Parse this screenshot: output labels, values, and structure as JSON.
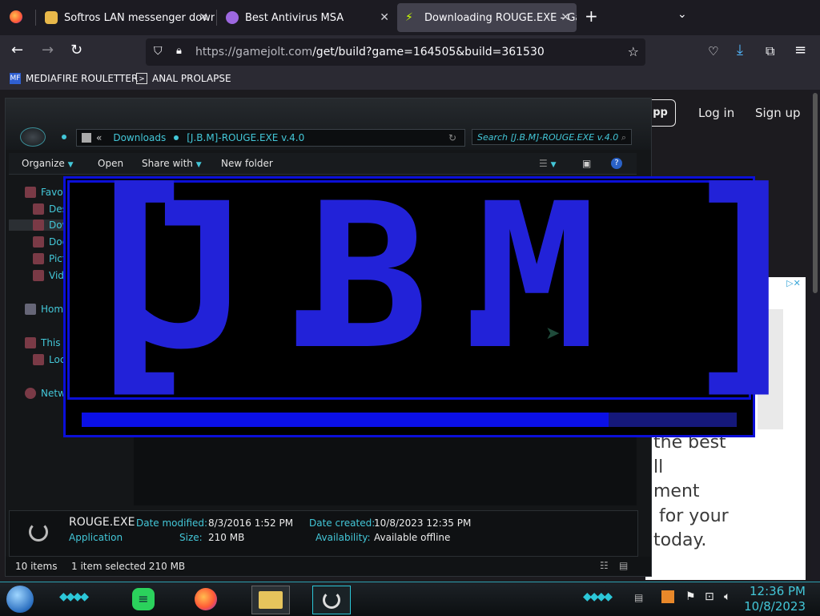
{
  "browser": {
    "tabs": [
      {
        "title": "Softros LAN messenger downlo",
        "active": false
      },
      {
        "title": "Best Antivirus MSA",
        "active": false
      },
      {
        "title": "Downloading ROUGE.EXE - Gan",
        "active": true
      }
    ],
    "url_host": "https://gamejolt.com",
    "url_path": "/get/build?game=164505&build=361530",
    "bookmarks": [
      "MEDIAFIRE ROULETTER",
      "ANAL PROLAPSE"
    ]
  },
  "gamejolt": {
    "app_button": "pp",
    "login": "Log in",
    "signup": "Sign up",
    "ad_text": "the best\nll\nment\n for your\ntoday."
  },
  "explorer": {
    "breadcrumb": [
      "Downloads",
      "[J.B.M]-ROUGE.EXE v.4.0"
    ],
    "breadcrumb_prefix": "«",
    "search_placeholder": "Search [J.B.M]-ROUGE.EXE v.4.0",
    "toolbar": {
      "organize": "Organize",
      "open": "Open",
      "share": "Share with",
      "newfolder": "New folder"
    },
    "nav": [
      "Favor",
      "Des",
      "Dow",
      "Doc",
      "Pict",
      "Vid",
      "Home",
      "This I",
      "Loc",
      "Netw"
    ],
    "details": {
      "name": "ROUGE.EXE",
      "type": "Application",
      "modified_label": "Date modified:",
      "modified": "8/3/2016 1:52 PM",
      "size_label": "Size:",
      "size": "210 MB",
      "created_label": "Date created:",
      "created": "10/8/2023 12:35 PM",
      "avail_label": "Availability:",
      "avail": "Available offline"
    },
    "status": {
      "items": "10 items",
      "selected": "1 item selected  210 MB"
    }
  },
  "overlay": {
    "logo": {
      "bracket_open": "[",
      "j": "J",
      "dot1": ".",
      "b": "B",
      "dot2": ".",
      "m": "M",
      "bracket_close": "]"
    },
    "progress": 0.805
  },
  "taskbar": {
    "time": "12:36 PM",
    "date": "10/8/2023"
  }
}
